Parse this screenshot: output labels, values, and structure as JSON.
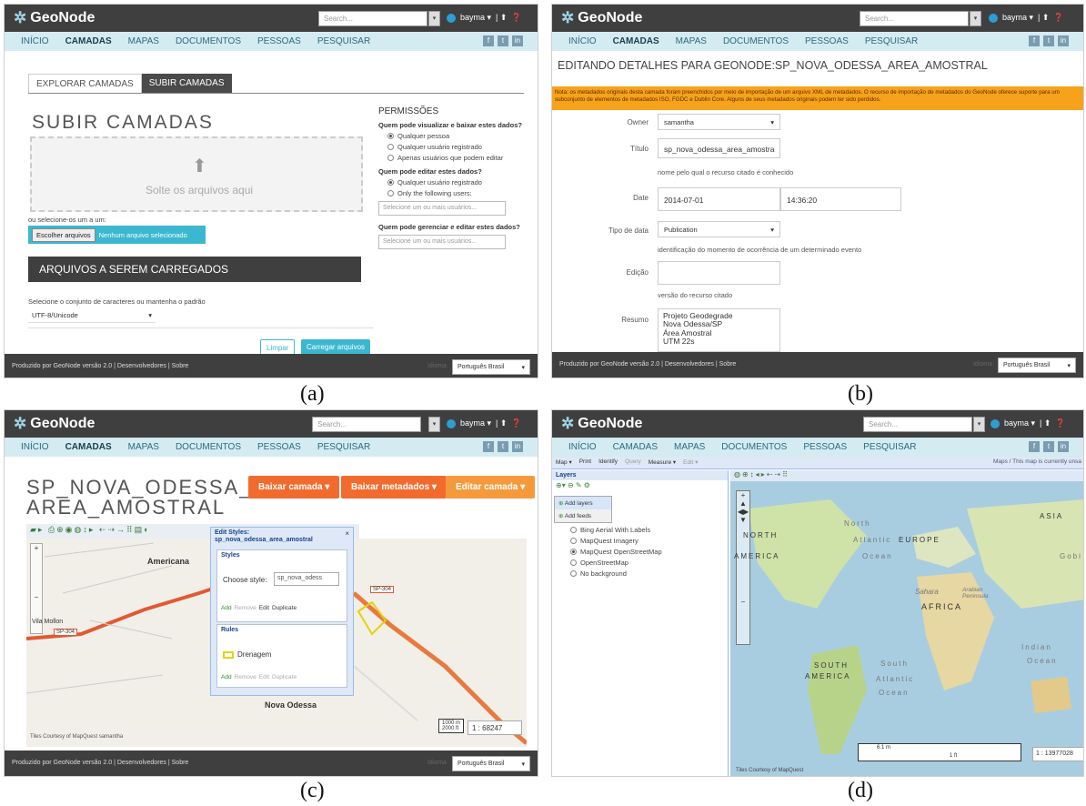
{
  "captions": {
    "a": "(a)",
    "b": "(b)",
    "c": "(c)",
    "d": "(d)"
  },
  "common": {
    "logo": "GeoNode",
    "search_placeholder": "Search...",
    "user": "bayma ▾",
    "nav": [
      "INÍCIO",
      "CAMADAS",
      "MAPAS",
      "DOCUMENTOS",
      "PESSOAS",
      "PESQUISAR"
    ],
    "footer": "Produzido por GeoNode versão 2.0 | Desenvolvedores | Sobre",
    "lang_label": "Idioma",
    "lang": "Português Brasil",
    "colors": {
      "topbar": "#3f3f3f",
      "navbar": "#d4ebf2",
      "accent": "#2c9ed4",
      "orange": "#f26b2e",
      "teal": "#3bb7d0"
    }
  },
  "a": {
    "tabs": [
      "EXPLORAR CAMADAS",
      "SUBIR CAMADAS"
    ],
    "title": "SUBIR CAMADAS",
    "drop_text": "Solte os arquivos aqui",
    "select_hint": "ou selecione-os um a um:",
    "choose_btn": "Escolher arquivos",
    "no_file": "Nenhum arquivo selecionado",
    "queue_title": "ARQUIVOS A SEREM CARREGADOS",
    "charset_hint": "Selecione o conjunto de caracteres ou mantenha o padrão",
    "charset": "UTF-8/Unicode",
    "clear_btn": "Limpar",
    "upload_btn": "Carregar arquivos",
    "perm_title": "PERMISSÕES",
    "q1": "Quem pode visualizar e baixar estes dados?",
    "q1_opts": [
      "Qualquer pessoa",
      "Qualquer usuário registrado",
      "Apenas usuários que podem editar"
    ],
    "q2": "Quem pode editar estes dados?",
    "q2_opts": [
      "Qualquer usuário registrado",
      "Only the following users:"
    ],
    "users_placeholder": "Selecione um ou mais usuários...",
    "q3": "Quem pode gerenciar e editar estes dados?"
  },
  "b": {
    "title": "EDITANDO DETALHES PARA GEONODE:SP_NOVA_ODESSA_AREA_AMOSTRAL",
    "notice": "Nota: os metadados originais desta camada foram preenchidos por meio de importação de um arquivo XML de metadados. O recurso de importação de metadados do GeoNode oferece suporte para um subconjunto de elementos de metadados ISO, FGDC e Dublin Core. Alguns de seus metadados originais podem ter sido perdidos.",
    "owner_label": "Owner",
    "owner": "samantha",
    "title_label": "Título",
    "title_value": "sp_nova_odessa_area_amostra",
    "title_hint": "nome pelo qual o recurso citado é conhecido",
    "date_label": "Date",
    "date": "2014-07-01",
    "time": "14:36:20",
    "datatype_label": "Tipo de data",
    "datatype": "Publication",
    "datatype_hint": "identificação do momento de ocorrência de um determinado evento",
    "edition_label": "Edição",
    "edition_hint": "versão do recurso citado",
    "abstract_label": "Resumo",
    "abstract": [
      "Projeto Geodegrade",
      "Nova Odessa/SP",
      "Área Amostral",
      "UTM 22s"
    ]
  },
  "c": {
    "title": "SP_NOVA_ODESSA_ AREA_AMOSTRAL",
    "btn_download": "Baixar camada ▾",
    "btn_metadata": "Baixar metadados ▾",
    "btn_edit": "Editar camada ▾",
    "dialog_title": "Edit Styles: sp_nova_odessa_area_amostral",
    "styles_legend": "Styles",
    "choose_style": "Choose style:",
    "style_value": "sp_nova_odess",
    "actions": [
      "Add",
      "Remove",
      "Edit",
      "Duplicate"
    ],
    "rules_legend": "Rules",
    "rule": "Drenagem",
    "places": [
      "Americana",
      "Vila Mollon",
      "Nova Odessa",
      "SP-304",
      "SP-304",
      "SP-304"
    ],
    "scale": "1 : 68247",
    "scalebar": [
      "1000 m",
      "2000 ft"
    ],
    "tiles": "Tiles Courtesy of MapQuest",
    "user": "samantha"
  },
  "d": {
    "toolbar": [
      "Map ▾",
      "Print",
      "Identify",
      "Query",
      "Measure ▾",
      "Edit ▾"
    ],
    "maps_note": "Maps / This map is currently unsa",
    "layers_title": "Layers",
    "menu": [
      "Add layers",
      "Add feeds"
    ],
    "layers": [
      "Bing Aerial With Labels",
      "MapQuest Imagery",
      "MapQuest OpenStreetMap",
      "OpenStreetMap",
      "No background"
    ],
    "geo": [
      "North",
      "EUROPE",
      "ASIA",
      "NORTH",
      "Atlantic",
      "AMERICA",
      "Ocean",
      "Gobi",
      "Sahara",
      "Arabian Peninsula",
      "AFRICA",
      "Indian",
      "Ocean",
      "SOUTH",
      "AMERICA",
      "South",
      "Atlantic",
      "Ocean"
    ],
    "scale": "1 : 13977028",
    "scalebar": [
      "6.1 m",
      "1 ft"
    ],
    "tiles": "Tiles Courtesy of MapQuest"
  }
}
